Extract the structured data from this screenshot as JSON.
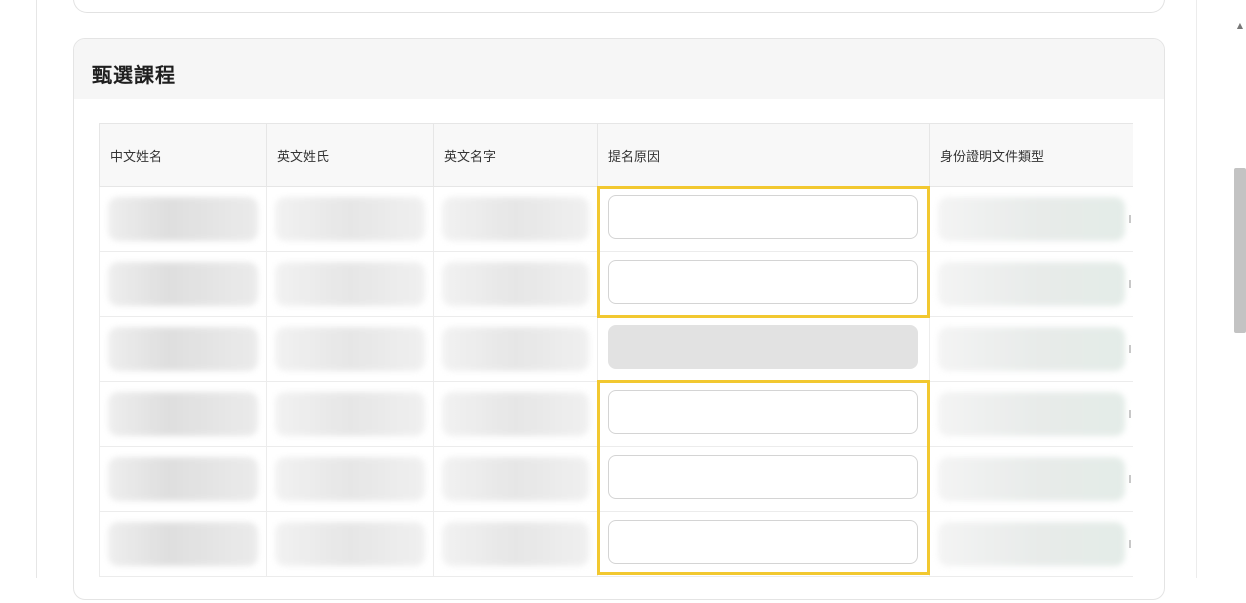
{
  "section": {
    "title": "甄選課程"
  },
  "table": {
    "headers": [
      "中文姓名",
      "英文姓氏",
      "英文名字",
      "提名原因",
      "身份證明文件類型"
    ],
    "rows": [
      {
        "reason_value": "",
        "disabled": false,
        "highlighted": true
      },
      {
        "reason_value": "",
        "disabled": false,
        "highlighted": true
      },
      {
        "reason_value": "",
        "disabled": true,
        "highlighted": false
      },
      {
        "reason_value": "",
        "disabled": false,
        "highlighted": true
      },
      {
        "reason_value": "",
        "disabled": false,
        "highlighted": true
      },
      {
        "reason_value": "",
        "disabled": false,
        "highlighted": true
      }
    ]
  },
  "colors": {
    "highlight": "#f2c830",
    "disabled_field": "#e2e2e2",
    "header_bg": "#f6f6f6"
  },
  "icons": {
    "scroll_up": "scroll-up-arrow-icon"
  }
}
